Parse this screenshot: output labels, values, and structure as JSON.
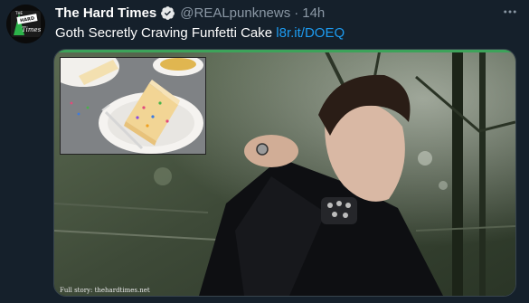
{
  "tweet": {
    "display_name": "The Hard Times",
    "handle": "@REALpunknews",
    "separator": "·",
    "time": "14h",
    "text": "Goth Secretly Craving Funfetti Cake ",
    "link_text": "l8r.it/DOEQ",
    "more_icon": "more-icon",
    "verified_icon": "verified-badge-icon"
  },
  "avatar": {
    "logo_lines": [
      "THE",
      "HARD",
      "Times"
    ]
  },
  "card": {
    "caption": "Full story: thehardtimes.net"
  },
  "colors": {
    "background": "#15202b",
    "accent_blue": "#1d9bf0",
    "muted_text": "#8b98a5",
    "card_accent": "#3da35a"
  }
}
